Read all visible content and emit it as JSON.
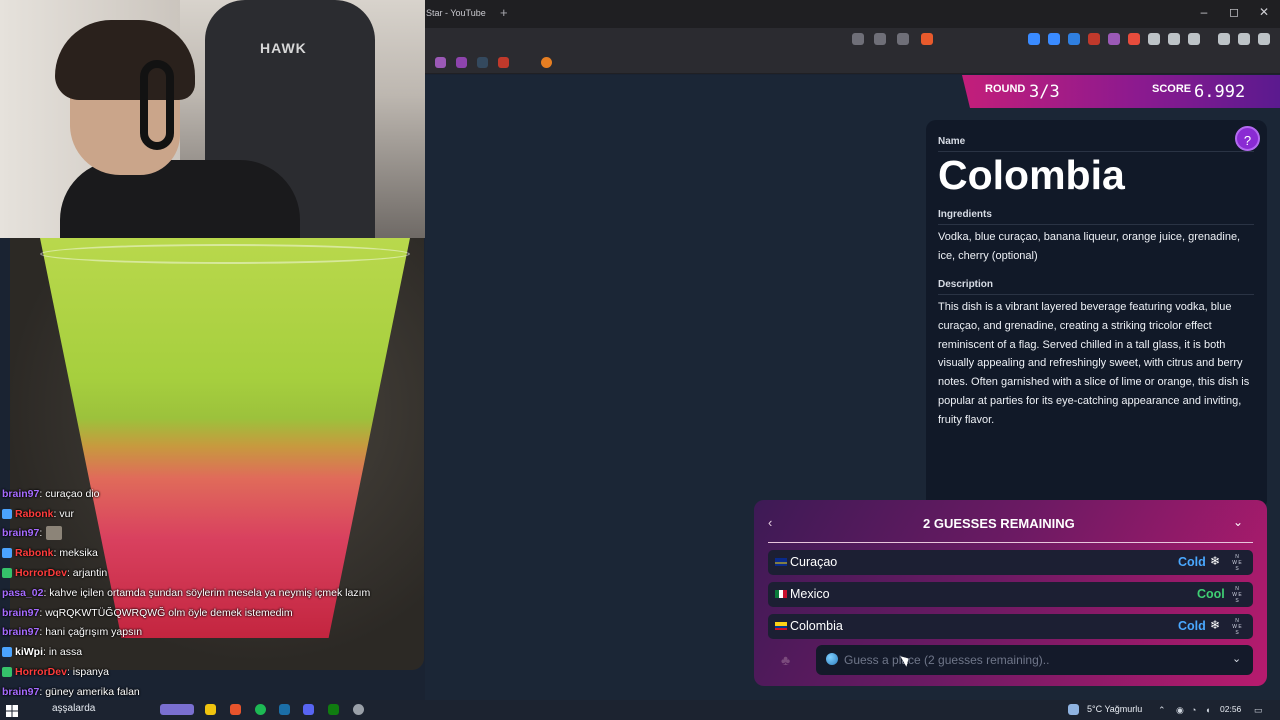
{
  "browser": {
    "tab_title": "Star - YouTube",
    "new_tab": "+",
    "minimize": "–",
    "maximize": "◻",
    "close": "✕"
  },
  "webcam": {
    "chair_brand": "HAWK"
  },
  "chat": [
    {
      "user": "brain97",
      "text": ": curaçao dio",
      "color": "#a66bff",
      "badge": ""
    },
    {
      "user": "Rabonk",
      "text": ": vur",
      "color": "#ff3c3c",
      "badge": "#4aa3ff"
    },
    {
      "user": "brain97",
      "text": ":",
      "color": "#a66bff",
      "badge": ""
    },
    {
      "user": "Rabonk",
      "text": ": meksika",
      "color": "#ff3c3c",
      "badge": "#4aa3ff"
    },
    {
      "user": "HorrorDev",
      "text": ": arjantin",
      "color": "#ff3c3c",
      "badge": "#35c26b"
    },
    {
      "user": "pasa_02",
      "text": ": kahve içilen ortamda şundan söylerim mesela ya neymiş içmek lazım",
      "color": "#a66bff",
      "badge": ""
    },
    {
      "user": "brain97",
      "text": ": wqRQKWTÜĞQWRQWĞ olm öyle demek istemedim",
      "color": "#a66bff",
      "badge": ""
    },
    {
      "user": "brain97",
      "text": ": hani çağrışım yapsın",
      "color": "#a66bff",
      "badge": ""
    },
    {
      "user": "kiWpi",
      "text": ": in assa",
      "color": "#ffffff",
      "badge": "#4aa3ff"
    },
    {
      "user": "HorrorDev",
      "text": ": ispanya",
      "color": "#ff3c3c",
      "badge": "#35c26b"
    },
    {
      "user": "brain97",
      "text": ": güney amerika falan",
      "color": "#a66bff",
      "badge": ""
    }
  ],
  "taskbar": {
    "search_text": "aşşalarda",
    "weather": "5°C  Yağmurlu",
    "time": "02:56"
  },
  "game": {
    "round_label": "ROUND",
    "round_value": "3/3",
    "score_label": "SCORE",
    "score_value": "6.992",
    "help_icon": "?",
    "name_label": "Name",
    "country": "Colombia",
    "ingredients_label": "Ingredients",
    "ingredients": "Vodka, blue curaçao, banana liqueur, orange juice, grenadine, ice, cherry (optional)",
    "description_label": "Description",
    "description": "This dish is a vibrant layered beverage featuring vodka, blue curaçao, and grenadine, creating a striking tricolor effect reminiscent of a flag. Served chilled in a tall glass, it is both visually appealing and refreshingly sweet, with citrus and berry notes. Often garnished with a slice of lime or orange, this dish is popular at parties for its eye-catching appearance and inviting, fruity flavor.",
    "guesses_title": "2 GUESSES REMAINING",
    "guesses": [
      {
        "name": "Curaçao",
        "temp": "Cold",
        "temp_color": "#4aa8ff",
        "snow": true
      },
      {
        "name": "Mexico",
        "temp": "Cool",
        "temp_color": "#3fcf74",
        "snow": false
      },
      {
        "name": "Colombia",
        "temp": "Cold",
        "temp_color": "#4aa8ff",
        "snow": true
      }
    ],
    "compass": {
      "n": "N",
      "w": "W",
      "e": "E",
      "s": "S"
    },
    "input_placeholder": "Guess a place (2 guesses remaining)..",
    "input_value": ""
  }
}
